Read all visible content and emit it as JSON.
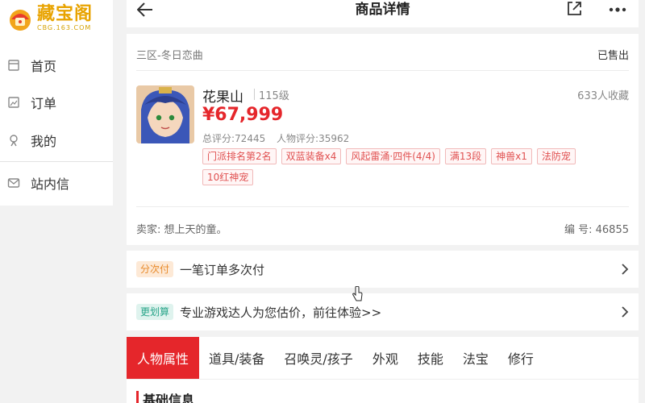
{
  "logo": {
    "text": "藏宝阁",
    "subtext": "CBG.163.COM"
  },
  "sidebar": {
    "items": [
      {
        "label": "首页",
        "icon": "home-icon"
      },
      {
        "label": "订单",
        "icon": "order-icon"
      },
      {
        "label": "我的",
        "icon": "user-icon"
      },
      {
        "label": "站内信",
        "icon": "mail-icon"
      }
    ]
  },
  "topbar": {
    "title": "商品详情"
  },
  "product": {
    "server": "三区-冬日恋曲",
    "status": "已售出",
    "name": "花果山",
    "level": "115级",
    "favorites": "633人收藏",
    "price": "¥67,999",
    "total_score": "总评分:72445",
    "character_score": "人物评分:35962",
    "tags": [
      "门派排名第2名",
      "双蓝装备x4",
      "风起雷涌·四件(4/4)",
      "满13段",
      "神兽x1",
      "法防宠",
      "10红神宠"
    ],
    "seller": "卖家: 想上天的童。",
    "serial": "编 号: 46855"
  },
  "promos": [
    {
      "badge": "分次付",
      "text": "一笔订单多次付"
    },
    {
      "badge": "更划算",
      "text": "专业游戏达人为您估价，前往体验>>"
    }
  ],
  "tabs": [
    "人物属性",
    "道具/装备",
    "召唤灵/孩子",
    "外观",
    "技能",
    "法宝",
    "修行"
  ],
  "section": {
    "title": "基础信息"
  },
  "colors": {
    "accent": "#e5262b",
    "brand": "#e8a300"
  }
}
